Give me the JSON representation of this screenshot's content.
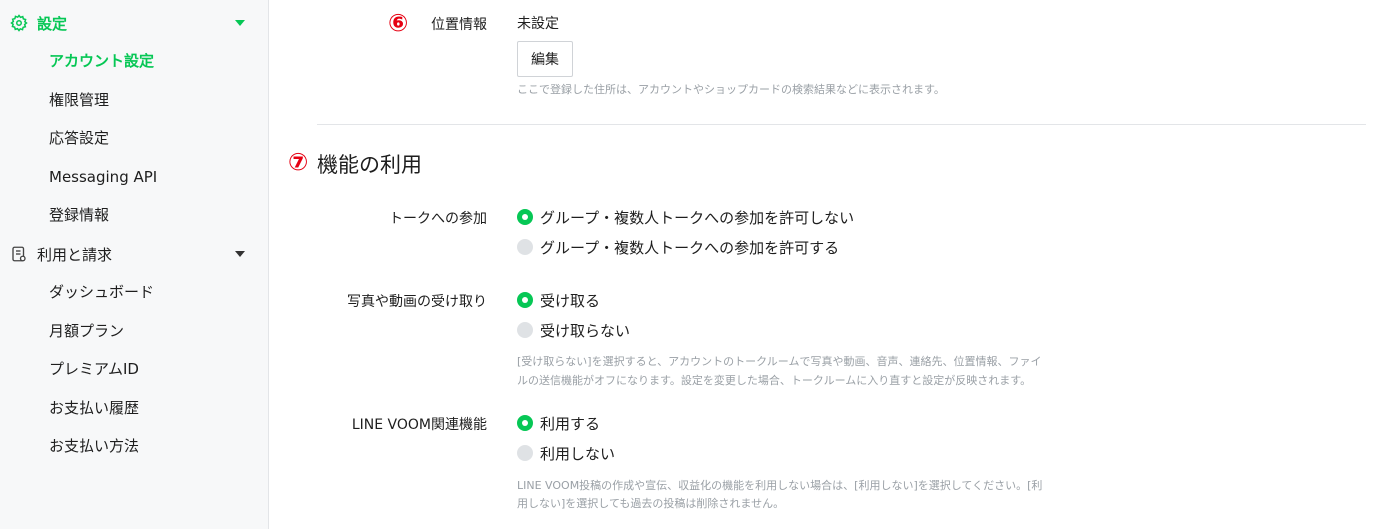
{
  "sidebar": {
    "settings_section": {
      "label": "設定",
      "icon": "gear-icon"
    },
    "settings_items": [
      {
        "label": "アカウント設定",
        "current": true
      },
      {
        "label": "権限管理"
      },
      {
        "label": "応答設定"
      },
      {
        "label": "Messaging API"
      },
      {
        "label": "登録情報"
      }
    ],
    "billing_section": {
      "label": "利用と請求",
      "icon": "document-icon"
    },
    "billing_items": [
      {
        "label": "ダッシュボード"
      },
      {
        "label": "月額プラン"
      },
      {
        "label": "プレミアムID"
      },
      {
        "label": "お支払い履歴"
      },
      {
        "label": "お支払い方法"
      }
    ]
  },
  "location": {
    "marker": "⑥",
    "label": "位置情報",
    "value": "未設定",
    "edit_button": "編集",
    "help": "ここで登録した住所は、アカウントやショップカードの検索結果などに表示されます。"
  },
  "features": {
    "marker": "⑦",
    "title": "機能の利用",
    "talk_join": {
      "label": "トークへの参加",
      "options": [
        "グループ・複数人トークへの参加を許可しない",
        "グループ・複数人トークへの参加を許可する"
      ],
      "selected": 0
    },
    "media_receive": {
      "label": "写真や動画の受け取り",
      "options": [
        "受け取る",
        "受け取らない"
      ],
      "selected": 0,
      "help_line1": "[受け取らない]を選択すると、アカウントのトークルームで写真や動画、音声、連絡先、位置情報、ファイ",
      "help_line2": "ルの送信機能がオフになります。設定を変更した場合、トークルームに入り直すと設定が反映されます。"
    },
    "voom": {
      "label": "LINE VOOM関連機能",
      "options": [
        "利用する",
        "利用しない"
      ],
      "selected": 0,
      "help_line1": "LINE VOOM投稿の作成や宣伝、収益化の機能を利用しない場合は、[利用しない]を選択してください。[利",
      "help_line2": "用しない]を選択しても過去の投稿は削除されません。"
    }
  },
  "colors": {
    "accent": "#06c755",
    "marker": "#e60012"
  }
}
